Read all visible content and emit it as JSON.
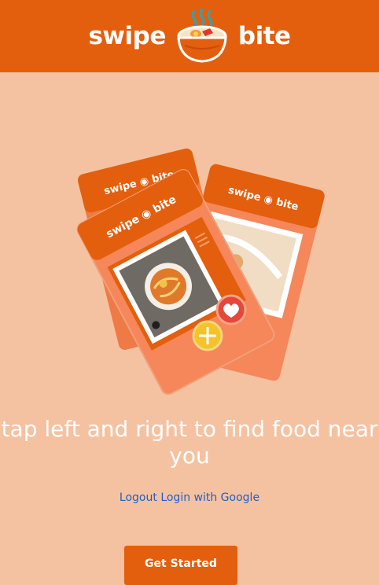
{
  "header": {
    "logo_left": "swipe",
    "logo_right": "bite",
    "logo_icon": "ramen-bowl-icon"
  },
  "illustration": {
    "card_logo_left": "swipe",
    "card_logo_right": "bite",
    "icons": [
      "heart-icon",
      "plus-icon",
      "menu-icon"
    ]
  },
  "tagline": "tap left and right to find food near you",
  "auth": {
    "logout_label": "Logout",
    "login_label": "Login with Google"
  },
  "cta": {
    "label": "Get Started"
  },
  "colors": {
    "brand_orange": "#e35f0e",
    "background_peach": "#f5c2a1",
    "card_light": "#f5875a",
    "heart_red": "#e5473a",
    "plus_yellow": "#f4c22b",
    "link_blue": "#1f5fc9"
  }
}
